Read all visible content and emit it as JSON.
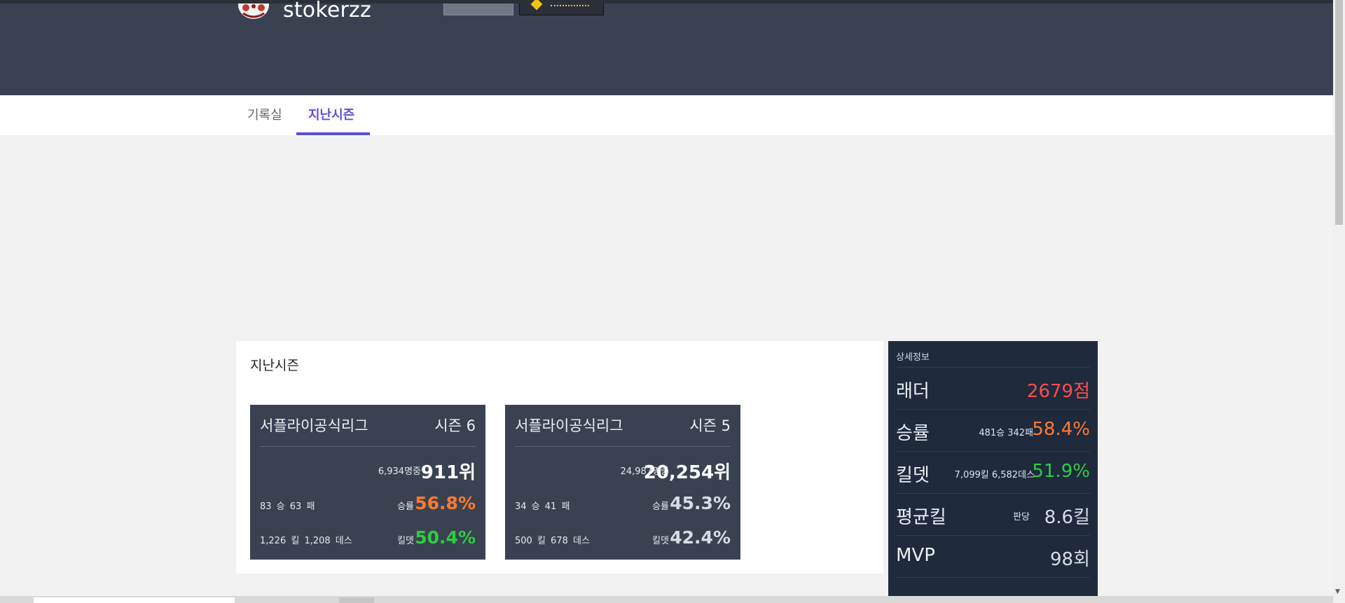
{
  "header": {
    "username": "stokerzz"
  },
  "tabs": [
    {
      "label": "기록실"
    },
    {
      "label": "지난시즌"
    }
  ],
  "section": {
    "title": "지난시즌"
  },
  "seasons": [
    {
      "league": "서플라이공식리그",
      "season": "시즌 6",
      "total": "6,934명중",
      "rank": "911위",
      "wl": "83 승 63 패",
      "winrate_label": "승률",
      "winrate": "56.8%",
      "kd_detail": "1,226 킬 1,208 데스",
      "kd_label": "킬뎃",
      "kd": "50.4%"
    },
    {
      "league": "서플라이공식리그",
      "season": "시즌 5",
      "total": "24,987명중",
      "rank": "20,254위",
      "wl": "34 승 41 패",
      "winrate_label": "승률",
      "winrate": "45.3%",
      "kd_detail": "500 킬 678 데스",
      "kd_label": "킬뎃",
      "kd": "42.4%"
    }
  ],
  "detail": {
    "title": "상세정보",
    "ladder": {
      "label": "래더",
      "value": "2679점"
    },
    "winrate": {
      "label": "승률",
      "detail": "481승 342패",
      "value": "58.4%"
    },
    "killdeath": {
      "label": "킬뎃",
      "detail": "7,099킬 6,582데스",
      "value": "51.9%"
    },
    "avgkill": {
      "label": "평균킬",
      "detail": "판당",
      "value": "8.6킬"
    },
    "mvp": {
      "label": "MVP",
      "value": "98회"
    }
  },
  "colors": {
    "header_bg": "#3a4252",
    "tab_active": "#5a4fd6",
    "season_card_bg": "#3a4252",
    "side_panel_bg": "#1f2a3d",
    "ladder_red": "#ff4d4f",
    "winrate_orange": "#ff7a2e",
    "kd_green": "#2ecc40",
    "neutral_value": "#d8dce4"
  }
}
